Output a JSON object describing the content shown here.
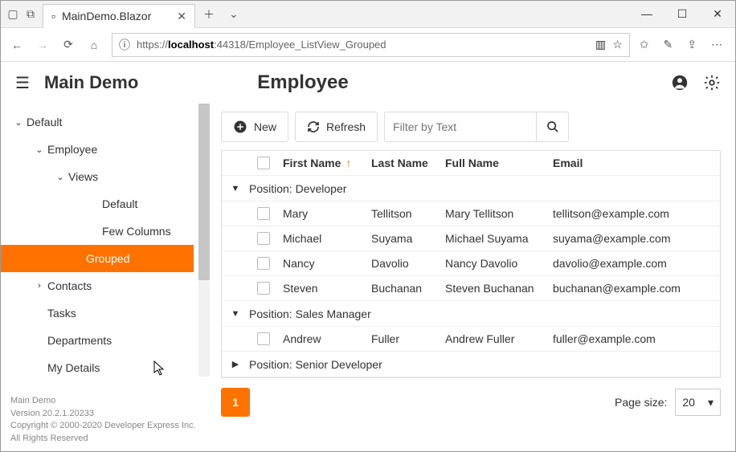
{
  "browser": {
    "tab_title": "MainDemo.Blazor",
    "url_prefix": "https://",
    "url_host": "localhost",
    "url_port_path": ":44318/Employee_ListView_Grouped"
  },
  "header": {
    "app_title": "Main Demo",
    "page_title": "Employee"
  },
  "sidebar": {
    "root": "Default",
    "employee": "Employee",
    "views": "Views",
    "view_default": "Default",
    "view_fewcols": "Few Columns",
    "view_grouped": "Grouped",
    "contacts": "Contacts",
    "tasks": "Tasks",
    "departments": "Departments",
    "mydetails": "My Details"
  },
  "footer": {
    "l1": "Main Demo",
    "l2": "Version 20.2.1.20233",
    "l3": "Copyright © 2000-2020 Developer Express Inc.",
    "l4": "All Rights Reserved"
  },
  "toolbar": {
    "new_label": "New",
    "refresh_label": "Refresh",
    "filter_placeholder": "Filter by Text"
  },
  "grid": {
    "cols": {
      "fn": "First Name",
      "ln": "Last Name",
      "full": "Full Name",
      "email": "Email"
    },
    "groups": [
      {
        "title": "Position: Developer",
        "expanded": true,
        "rows": [
          {
            "fn": "Mary",
            "ln": "Tellitson",
            "full": "Mary Tellitson",
            "email": "tellitson@example.com"
          },
          {
            "fn": "Michael",
            "ln": "Suyama",
            "full": "Michael Suyama",
            "email": "suyama@example.com"
          },
          {
            "fn": "Nancy",
            "ln": "Davolio",
            "full": "Nancy Davolio",
            "email": "davolio@example.com"
          },
          {
            "fn": "Steven",
            "ln": "Buchanan",
            "full": "Steven Buchanan",
            "email": "buchanan@example.com"
          }
        ]
      },
      {
        "title": "Position: Sales Manager",
        "expanded": true,
        "rows": [
          {
            "fn": "Andrew",
            "ln": "Fuller",
            "full": "Andrew Fuller",
            "email": "fuller@example.com"
          }
        ]
      },
      {
        "title": "Position: Senior Developer",
        "expanded": false,
        "rows": []
      }
    ]
  },
  "pager": {
    "current": "1",
    "page_size_label": "Page size:",
    "page_size_value": "20"
  }
}
